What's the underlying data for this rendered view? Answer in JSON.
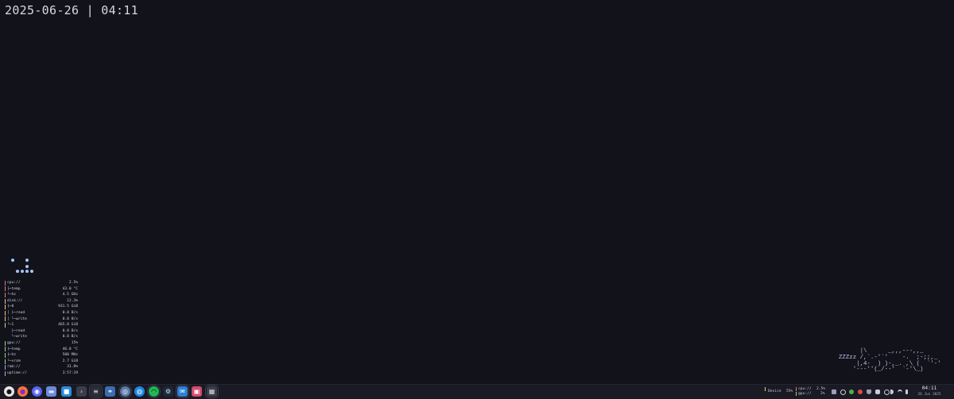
{
  "desktop": {
    "clock": "2025-06-26 | 04:11"
  },
  "sysmon": {
    "rows": [
      {
        "label": "cpu://",
        "value": "2.5%",
        "color": "#e87b7b"
      },
      {
        "label": "├─temp",
        "value": "43.0 °C",
        "color": "#e87b7b"
      },
      {
        "label": "└─hz",
        "value": "4.5 GHz",
        "color": "#e87b7b"
      },
      {
        "label": "disk://",
        "value": "12.3%",
        "color": "#e9c98a"
      },
      {
        "label": "├─0",
        "value": "931.5 GiB",
        "color": "#e9c98a"
      },
      {
        "label": "│ ├─read",
        "value": "0.0 B/s",
        "color": "#e9c98a"
      },
      {
        "label": "│ └─write",
        "value": "0.0 B/s",
        "color": "#e9c98a"
      },
      {
        "label": "└─1",
        "value": "465.8 GiB",
        "color": "#e9c98a"
      },
      {
        "label": "  ├─read",
        "value": "0.0 B/s",
        "color": ""
      },
      {
        "label": "  └─write",
        "value": "0.0 B/s",
        "color": ""
      },
      {
        "label": "gpu://",
        "value": "15%",
        "color": "#9fd67f"
      },
      {
        "label": "├─temp",
        "value": "46.0 °C",
        "color": "#9fd67f"
      },
      {
        "label": "├─hz",
        "value": "500 MHz",
        "color": "#9fd67f"
      },
      {
        "label": "└─vram",
        "value": "2.7 GiB",
        "color": "#9fd67f"
      },
      {
        "label": "ram://",
        "value": "31.8%",
        "color": "#8fb3f0"
      },
      {
        "label": "uptime://",
        "value": "3:57:19",
        "color": "#c59af0"
      }
    ]
  },
  "ascii_cat": "      |\\      _,,,---,,_\nZZZzz /,`.-'`'    -.  ;-;;,_\n     |,4-  ) )-,_. ,\\ (  `'-'\n    '---''(_/--'  `-'\\_)",
  "taskbar": {
    "apps": [
      {
        "name": "github-icon",
        "glyph": "●",
        "bg": "#e6e6e6",
        "fg": "#111"
      },
      {
        "name": "firefox-icon",
        "glyph": "●",
        "bg": "#ff7139",
        "fg": "#7b2fd3"
      },
      {
        "name": "discord-icon",
        "glyph": "◉",
        "bg": "#5865f2",
        "fg": "#fff"
      },
      {
        "name": "files-icon",
        "glyph": "▬",
        "bg": "#6a8bd8",
        "fg": "#dfe7ff"
      },
      {
        "name": "store-icon",
        "glyph": "■",
        "bg": "#2a8be0",
        "fg": "#fff"
      },
      {
        "name": "terminal-icon",
        "glyph": "›",
        "bg": "#3a3d4a",
        "fg": "#ddd"
      },
      {
        "name": "system-monitor-icon",
        "glyph": "≡",
        "bg": "#2b2d3a",
        "fg": "#ddd"
      },
      {
        "name": "network-icon",
        "glyph": "⚭",
        "bg": "#3b6db0",
        "fg": "#fff"
      },
      {
        "name": "emu-icon",
        "glyph": "◎",
        "bg": "#5a7aa8",
        "fg": "#fff"
      },
      {
        "name": "browser-icon",
        "glyph": "◍",
        "bg": "#1e88e5",
        "fg": "#fff"
      },
      {
        "name": "spotify-icon",
        "glyph": "◠",
        "bg": "#1db954",
        "fg": "#111"
      },
      {
        "name": "steam-icon",
        "glyph": "⚙",
        "bg": "#1b2838",
        "fg": "#cfe3ff"
      },
      {
        "name": "mail-icon",
        "glyph": "✉",
        "bg": "#2d7fd6",
        "fg": "#fff"
      },
      {
        "name": "media-icon",
        "glyph": "▣",
        "bg": "#d64a6e",
        "fg": "#fff"
      },
      {
        "name": "settings-icon",
        "glyph": "▦",
        "bg": "#3a3d4a",
        "fg": "#ddd"
      }
    ],
    "tray": {
      "audio_label": "Device",
      "audio_value": "55%",
      "cpu_label": "cpu://",
      "cpu_value": "2.5%",
      "gpu_label": "gpu://",
      "gpu_value": "2%",
      "time": "04:11",
      "date": "26 Jun 2025"
    }
  }
}
